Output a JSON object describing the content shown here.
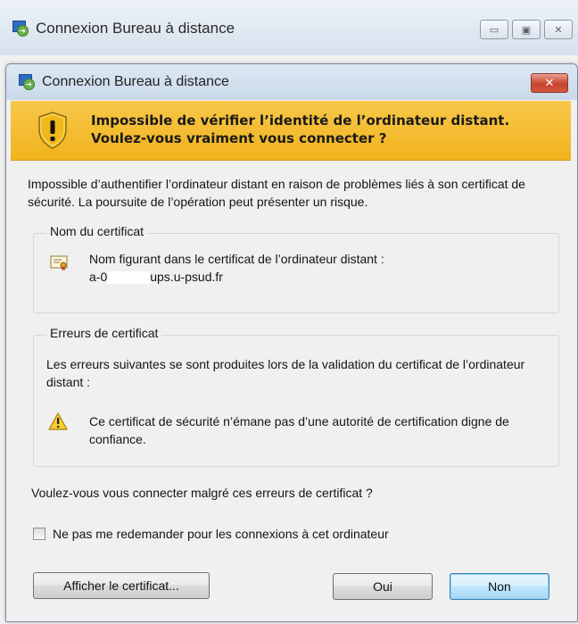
{
  "outer_window": {
    "title": "Connexion Bureau à distance",
    "minimize_glyph": "▭",
    "maximize_glyph": "▣",
    "close_glyph": "✕"
  },
  "dialog": {
    "title": "Connexion Bureau à distance",
    "close_glyph": "✕",
    "warning_line1": "Impossible de vérifier l’identité de l’ordinateur distant.",
    "warning_line2": "Voulez-vous vraiment vous connecter ?",
    "description": "Impossible d’authentifier l’ordinateur distant en raison de problèmes liés à son certificat de sécurité. La poursuite de l’opération peut présenter un risque.",
    "cert_name_group": {
      "title": "Nom du certificat",
      "label": "Nom figurant dans le certificat de l’ordinateur distant :",
      "value_prefix": "a-0",
      "value_suffix": "ups.u-psud.fr"
    },
    "cert_errors_group": {
      "title": "Erreurs de certificat",
      "intro": "Les erreurs suivantes se sont produites lors de la validation du certificat de l’ordinateur distant :",
      "error": "Ce certificat de sécurité n’émane pas d’une autorité de certification digne de confiance."
    },
    "question": "Voulez-vous vous connecter malgré ces erreurs de certificat ?",
    "checkbox_label": "Ne pas me redemander pour les connexions à cet ordinateur",
    "checkbox_checked": false,
    "buttons": {
      "view_certificate": "Afficher le certificat...",
      "yes": "Oui",
      "no": "Non"
    }
  },
  "icons": {
    "app": "remote-desktop-icon",
    "shield": "warning-shield-icon",
    "certificate": "certificate-icon",
    "warning": "warning-triangle-icon"
  },
  "colors": {
    "banner": "#f1b21d",
    "close_button": "#c7422c",
    "default_button_border": "#3c7fb1"
  }
}
